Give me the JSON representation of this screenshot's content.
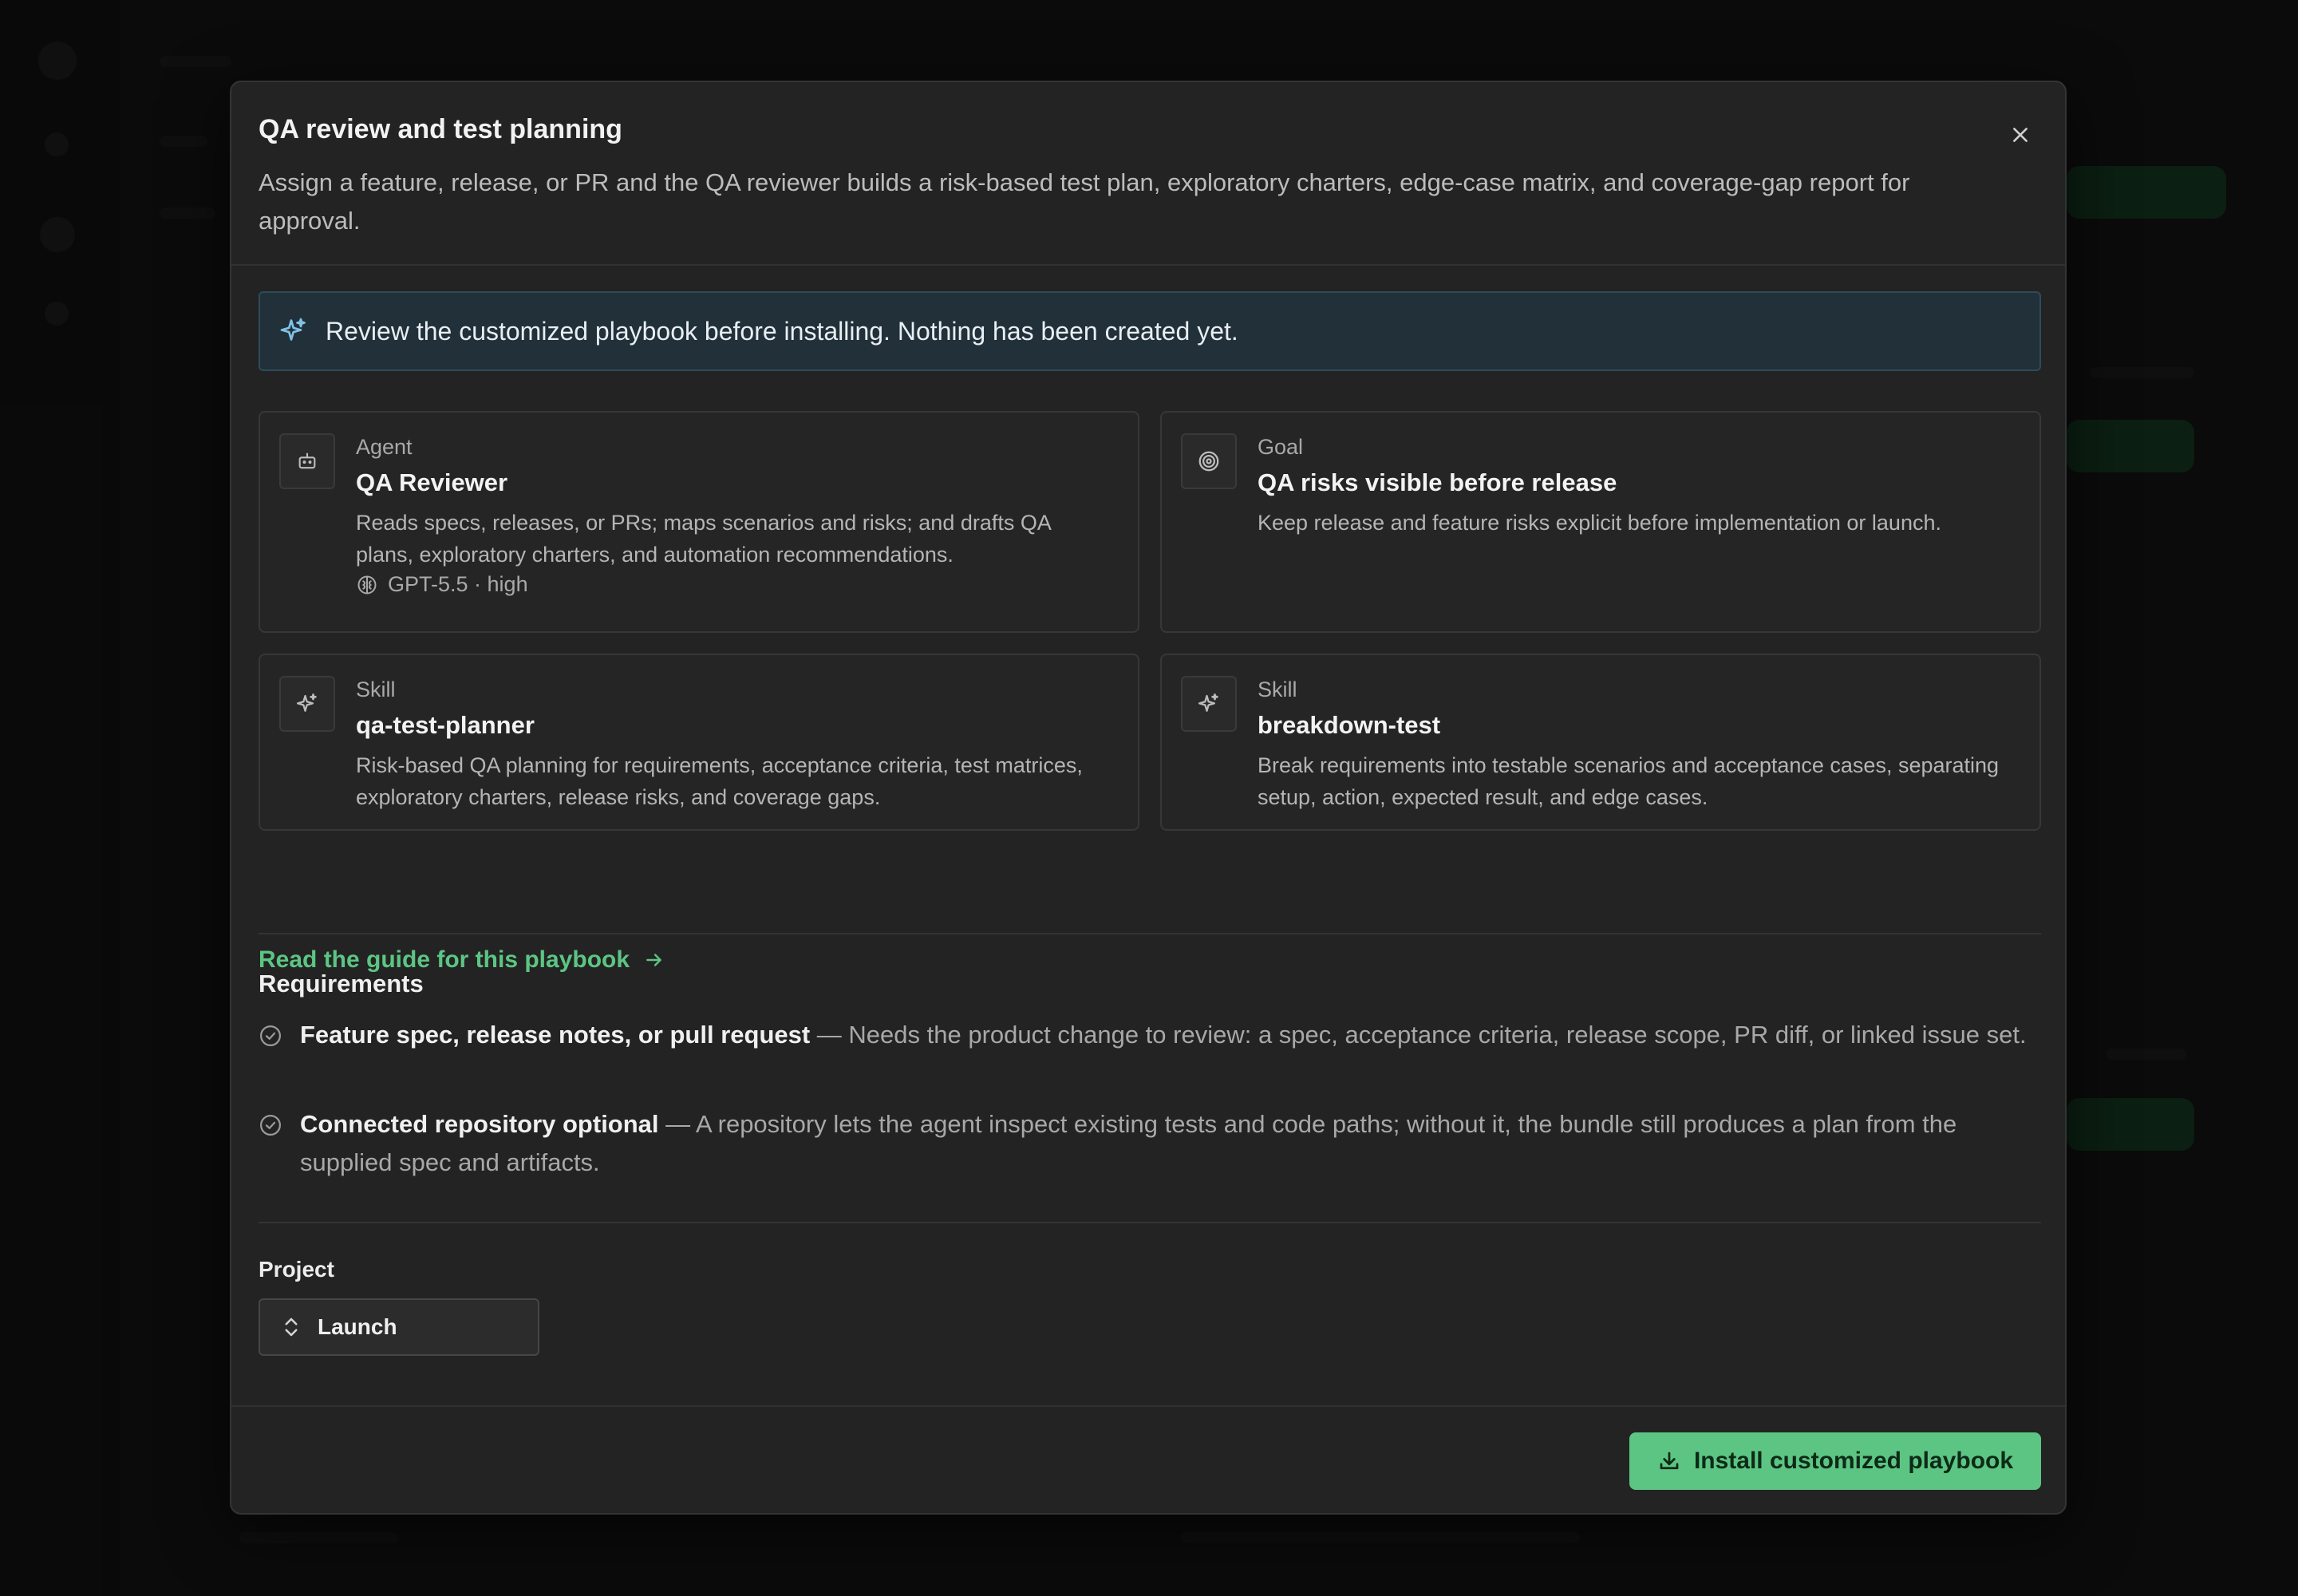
{
  "modal": {
    "title": "QA review and test planning",
    "description": "Assign a feature, release, or PR and the QA reviewer builds a risk-based test plan, exploratory charters, edge-case matrix, and coverage-gap report for approval.",
    "close_icon": "close-icon"
  },
  "banner": {
    "icon": "sparkle-icon",
    "text": "Review the customized playbook before installing. Nothing has been created yet."
  },
  "cards": [
    {
      "kind": "Agent",
      "name": "QA Reviewer",
      "description": "Reads specs, releases, or PRs; maps scenarios and risks; and drafts QA plans, exploratory charters, and automation recommendations.",
      "meta": "GPT-5.5 · high",
      "icon": "robot-icon",
      "meta_icon": "brain-icon"
    },
    {
      "kind": "Goal",
      "name": "QA risks visible before release",
      "description": "Keep release and feature risks explicit before implementation or launch.",
      "icon": "target-icon"
    },
    {
      "kind": "Skill",
      "name": "qa-test-planner",
      "description": "Risk-based QA planning for requirements, acceptance criteria, test matrices, exploratory charters, release risks, and coverage gaps.",
      "icon": "sparkle-icon"
    },
    {
      "kind": "Skill",
      "name": "breakdown-test",
      "description": "Break requirements into testable scenarios and acceptance cases, separating setup, action, expected result, and edge cases.",
      "icon": "sparkle-icon"
    }
  ],
  "guide_link": {
    "label": "Read the guide for this playbook",
    "icon": "arrow-right-icon"
  },
  "requirements": {
    "title": "Requirements",
    "items": [
      {
        "name": "Feature spec, release notes, or pull request",
        "detail": " — Needs the product change to review: a spec, acceptance criteria, release scope, PR diff, or linked issue set."
      },
      {
        "name": "Connected repository optional",
        "detail": " — A repository lets the agent inspect existing tests and code paths; without it, the bundle still produces a plan from the supplied spec and artifacts."
      }
    ]
  },
  "project": {
    "label": "Project",
    "selected": "Launch"
  },
  "install_button": {
    "label": "Install customized playbook",
    "icon": "download-icon"
  },
  "colors": {
    "accent": "#5cc583",
    "banner_bg": "#213039",
    "modal_bg": "#232323"
  }
}
